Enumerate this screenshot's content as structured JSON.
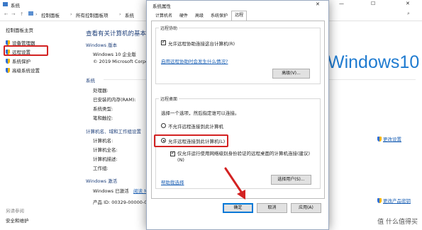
{
  "bg_window": {
    "title": "系统",
    "address": [
      "控制面板",
      "所有控制面板项",
      "系统"
    ],
    "controls": {
      "minimize": "—",
      "maximize": "☐",
      "close": "✕"
    }
  },
  "sidebar": {
    "home": "控制面板主页",
    "items": [
      {
        "label": "设备管理器"
      },
      {
        "label": "远程设置"
      },
      {
        "label": "系统保护"
      },
      {
        "label": "高级系统设置"
      }
    ],
    "see_also_title": "另请参阅",
    "see_also_items": [
      "安全和维护"
    ]
  },
  "main": {
    "heading": "查看有关计算机的基本信息",
    "edition_title": "Windows 版本",
    "edition": "Windows 10 企业版",
    "copyright": "© 2019 Microsoft Corpora",
    "logo_text": "Windows10",
    "system_title": "系统",
    "system_rows": [
      "处理器:",
      "已安装的内存(RAM):",
      "系统类型:",
      "笔和触控:"
    ],
    "computer_title": "计算机名、域和工作组设置",
    "computer_rows": [
      "计算机名:",
      "计算机全名:",
      "计算机描述:",
      "工作组:"
    ],
    "change_settings": "更改设置",
    "activation_title": "Windows 激活",
    "activation_status": "Windows 已激活",
    "activation_link": "阅读 Mic",
    "product_id": "产品 ID: 00329-00000-000",
    "change_product_key": "更改产品密钥"
  },
  "dialog": {
    "title": "系统属性",
    "close": "✕",
    "tabs": [
      "计算机名",
      "硬件",
      "高级",
      "系统保护",
      "远程"
    ],
    "active_tab": "远程",
    "remote_assist": {
      "group": "远程协助",
      "allow_checkbox": "允许远程协助连接这台计算机(R)",
      "allow_checked": true,
      "link": "启用远程协助时会发生什么情况?",
      "advanced_button": "高级(V)..."
    },
    "remote_desktop": {
      "group": "远程桌面",
      "instruction": "选择一个选项，然后指定谁可以连接。",
      "option_deny": "不允许远程连接到此计算机",
      "option_allow": "允许远程连接到此计算机(L)",
      "selected": "allow",
      "nla_checkbox": "仅允许运行使用网络级别身份验证的远程桌面的计算机连接(建议)(N)",
      "nla_checked": true,
      "help_link": "帮助我选择",
      "select_users_button": "选择用户(S)..."
    },
    "buttons": {
      "ok": "确定",
      "cancel": "取消",
      "apply": "应用(A)"
    }
  },
  "watermark": "值 什么值得买",
  "colors": {
    "accent": "#1f7bd0",
    "highlight": "#d32222",
    "link": "#1a5fb4"
  }
}
